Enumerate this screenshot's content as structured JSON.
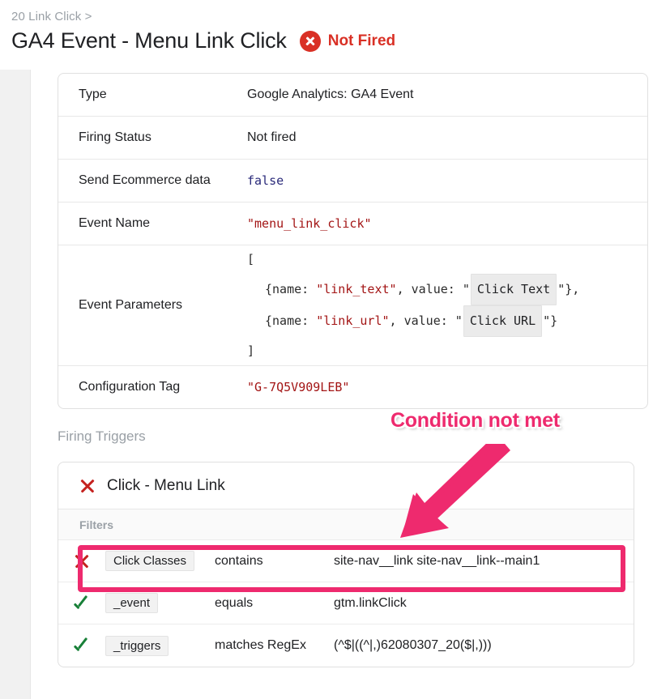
{
  "header": {
    "breadcrumb": "20 Link Click >",
    "title": "GA4 Event - Menu Link Click",
    "status_label": "Not Fired",
    "status_icon": "error-circle-icon",
    "status_color": "#d93025"
  },
  "detail_table": {
    "rows": [
      {
        "key": "Type",
        "value": "Google Analytics: GA4 Event",
        "style": "plain"
      },
      {
        "key": "Firing Status",
        "value": "Not fired",
        "style": "plain"
      },
      {
        "key": "Send Ecommerce data",
        "value": "false",
        "style": "bool"
      },
      {
        "key": "Event Name",
        "value": "\"menu_link_click\"",
        "style": "string"
      },
      {
        "key": "Event Parameters",
        "value": "",
        "style": "params"
      },
      {
        "key": "Configuration Tag",
        "value": "\"G-7Q5V909LEB\"",
        "style": "string"
      }
    ],
    "event_parameters": {
      "open_bracket": "[",
      "close_bracket": "]",
      "entries": [
        {
          "prefix": "{name: ",
          "name": "\"link_text\"",
          "mid": ", value: \"",
          "chip": "Click Text",
          "suffix": "\"},"
        },
        {
          "prefix": "{name: ",
          "name": "\"link_url\"",
          "mid": ", value: \"",
          "chip": "Click URL",
          "suffix": "\"}"
        }
      ]
    }
  },
  "firing_triggers": {
    "section_label": "Firing Triggers",
    "trigger": {
      "status_icon": "x-mark-icon",
      "name": "Click - Menu Link",
      "filters_header": "Filters",
      "filters": [
        {
          "status": "fail",
          "status_icon": "x-mark-icon",
          "variable": "Click Classes",
          "operator": "contains",
          "value": "site-nav__link site-nav__link--main1"
        },
        {
          "status": "pass",
          "status_icon": "check-mark-icon",
          "variable": "_event",
          "operator": "equals",
          "value": "gtm.linkClick"
        },
        {
          "status": "pass",
          "status_icon": "check-mark-icon",
          "variable": "_triggers",
          "operator": "matches RegEx",
          "value": "(^$|((^|,)62080307_20($|,)))"
        }
      ]
    }
  },
  "annotations": {
    "callout_text": "Condition not met",
    "callout_color": "#ee2a6e",
    "arrow_icon": "arrow-down-left-icon",
    "highlight_icon": "highlight-rectangle"
  }
}
